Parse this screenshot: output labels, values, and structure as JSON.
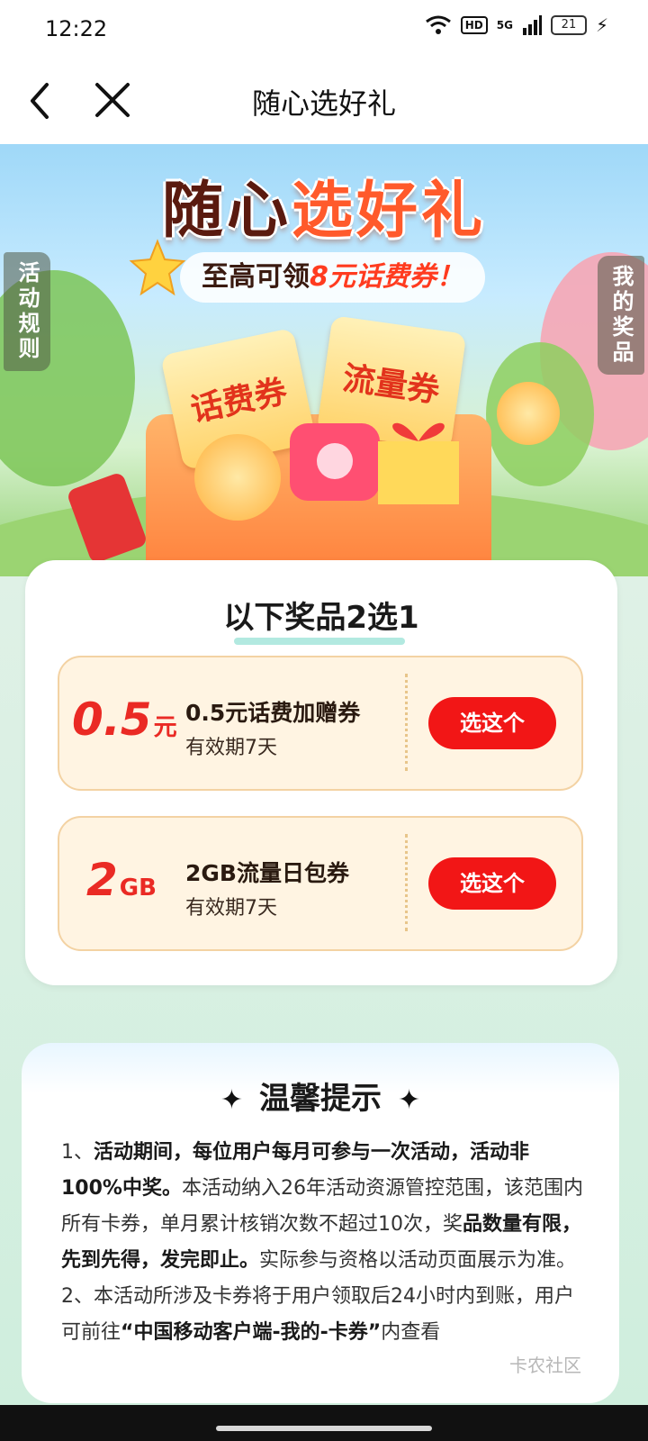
{
  "status_bar": {
    "time": "12:22",
    "hd": "HD",
    "network": "5G",
    "battery": "21"
  },
  "nav": {
    "title": "随心选好礼"
  },
  "hero": {
    "title_part1": "随心",
    "title_part2": "选好礼",
    "subtitle_prefix": "至高可领",
    "subtitle_highlight": "8元话费券！",
    "ticket_left": "话费券",
    "ticket_right": "流量券",
    "rules_tab": "活动规则",
    "my_prizes_tab": "我的奖品"
  },
  "prizes": {
    "heading": "以下奖品2选1",
    "items": [
      {
        "amount": "0.5",
        "unit": "元",
        "name": "0.5元话费加赠券",
        "validity": "有效期7天",
        "button": "选这个"
      },
      {
        "amount": "2",
        "unit": "GB",
        "name": "2GB流量日包券",
        "validity": "有效期7天",
        "button": "选这个"
      }
    ]
  },
  "tips": {
    "heading": "温馨提示",
    "p1_a": "1、",
    "p1_b": "活动期间，每位用户每月可参与一次活动，活动非100%中奖。",
    "p1_c": "本活动纳入26年活动资源管控范围，该范围内所有卡券，单月累计核销次数不超过10次，奖",
    "p1_d": "品数量有限，先到先得，发完即止。",
    "p1_e": "实际参与资格以活动页面展示为准。",
    "p2_a": "2、本活动所涉及卡券将于用户领取后24小时内到账，用户可前往",
    "p2_b": "“中国移动客户端-我的-卡券”",
    "p2_c": "内查看"
  },
  "watermark": "卡农社区",
  "colors": {
    "accent_red": "#f21616",
    "coupon_bg": "#fff4e2",
    "title_orange": "#ff5a2b"
  }
}
